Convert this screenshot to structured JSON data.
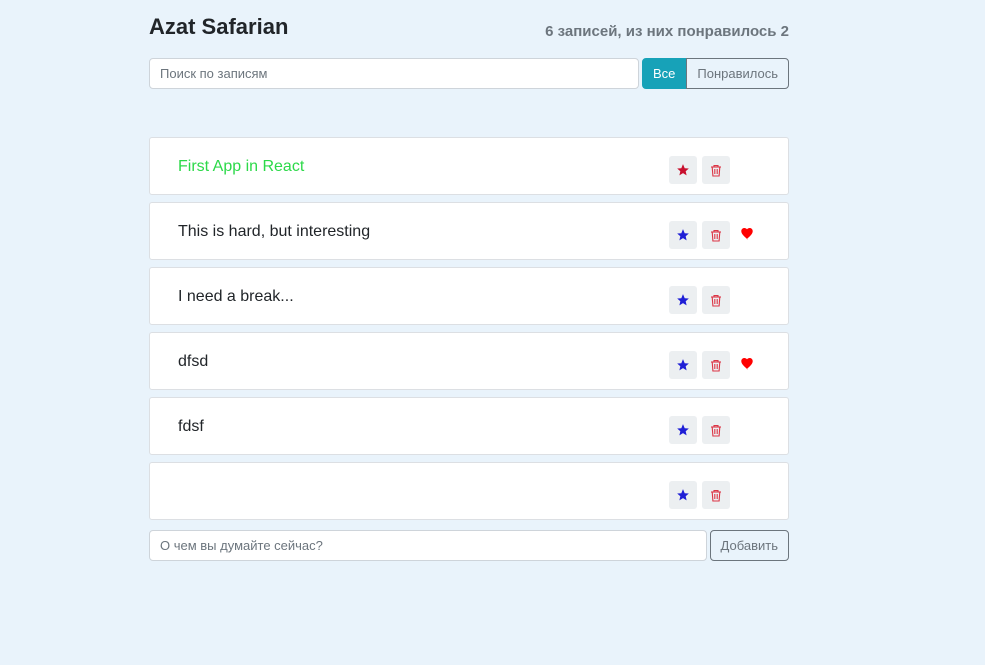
{
  "header": {
    "title": "Azat Safarian",
    "summary": "6 записей, из них понравилось 2"
  },
  "search": {
    "placeholder": "Поиск по записям",
    "value": ""
  },
  "filter": {
    "all_label": "Все",
    "liked_label": "Понравилось",
    "active": "all"
  },
  "posts": [
    {
      "label": "First App in React",
      "important": true,
      "liked": false
    },
    {
      "label": "This is hard, but interesting",
      "important": false,
      "liked": true
    },
    {
      "label": "I need a break...",
      "important": false,
      "liked": false
    },
    {
      "label": "dfsd",
      "important": false,
      "liked": true
    },
    {
      "label": "fdsf",
      "important": false,
      "liked": false
    },
    {
      "label": "",
      "important": false,
      "liked": false
    }
  ],
  "add_form": {
    "placeholder": "О чем вы думайте сейчас?",
    "value": "",
    "submit_label": "Добавить"
  },
  "colors": {
    "background": "#e9f3fb",
    "accent": "#17a2b8",
    "important_text": "#2cd949",
    "star_default": "#1f1fd6",
    "star_important": "#c8102e",
    "trash": "#dc3545",
    "heart": "#ff0000"
  },
  "icons": {
    "star": "star-icon",
    "trash": "trash-icon",
    "heart": "heart-icon"
  }
}
